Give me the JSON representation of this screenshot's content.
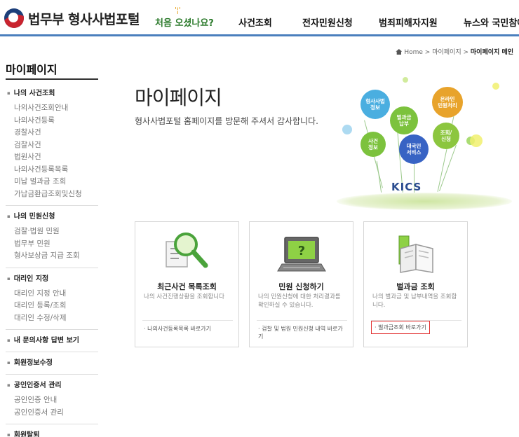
{
  "header": {
    "logo_text": "법무부 형사사법포털",
    "nav": [
      {
        "label": "처음 오셨나요?"
      },
      {
        "label": "사건조회"
      },
      {
        "label": "전자민원신청"
      },
      {
        "label": "범죄피해자지원"
      },
      {
        "label": "뉴스와 국민참여"
      }
    ]
  },
  "breadcrumb": {
    "home": "Home",
    "sep": ">",
    "level1": "마이페이지",
    "current": "마이페이지 메인"
  },
  "sidebar": {
    "title": "마이페이지",
    "groups": [
      {
        "title": "나의 사건조회",
        "items": [
          "나의사건조회안내",
          "나의사건등록",
          "경찰사건",
          "검찰사건",
          "법원사건",
          "나의사건등록목록",
          "미납 벌과금 조회",
          "가납금환급조회및신청"
        ]
      },
      {
        "title": "나의 민원신청",
        "items": [
          "검찰·법원 민원",
          "법무부 민원",
          "형사보상금 지급 조회"
        ]
      },
      {
        "title": "대리인 지정",
        "items": [
          "대리인 지정 안내",
          "대리인 등록/조회",
          "대리인 수정/삭제"
        ]
      },
      {
        "title": "내 문의사항 답변 보기",
        "items": []
      },
      {
        "title": "회원정보수정",
        "items": []
      },
      {
        "title": "공인인증서 관리",
        "items": [
          "공인인증 안내",
          "공인인증서 관리"
        ]
      },
      {
        "title": "회원탈퇴",
        "items": []
      }
    ]
  },
  "main": {
    "title": "마이페이지",
    "subtitle": "형사사법포털 홈페이지를 방문해 주셔서 감사합니다."
  },
  "illustration": {
    "bubbles": [
      "형사사법\n정보",
      "온라인\n민원처리",
      "벌과금\n납부",
      "조회/\n신청",
      "사건\n정보",
      "대국민\n서비스"
    ],
    "logo": "KICS"
  },
  "cards": [
    {
      "title": "최근사건 목록조회",
      "desc": "나의 사건진행상황을 조회합니다",
      "link": "· 나의사건등록목록 바로가기",
      "icon": "magnifier-document-icon"
    },
    {
      "title": "민원 신청하기",
      "desc": "나의 민원신청에 대한 처리결과를 확인하실 수 있습니다.",
      "link": "· 검찰 및 법원 민원신청 내역 바로가기",
      "icon": "computer-question-icon"
    },
    {
      "title": "벌과금 조회",
      "desc": "나의 벌과금 및 납부내역을 조회합니다.",
      "link": "· 벌과금조회 바로가기",
      "icon": "open-book-icon"
    }
  ],
  "colors": {
    "accent_blue": "#4a7fbd",
    "welcome_green": "#2b7a2b",
    "highlight_red": "#e23030"
  }
}
